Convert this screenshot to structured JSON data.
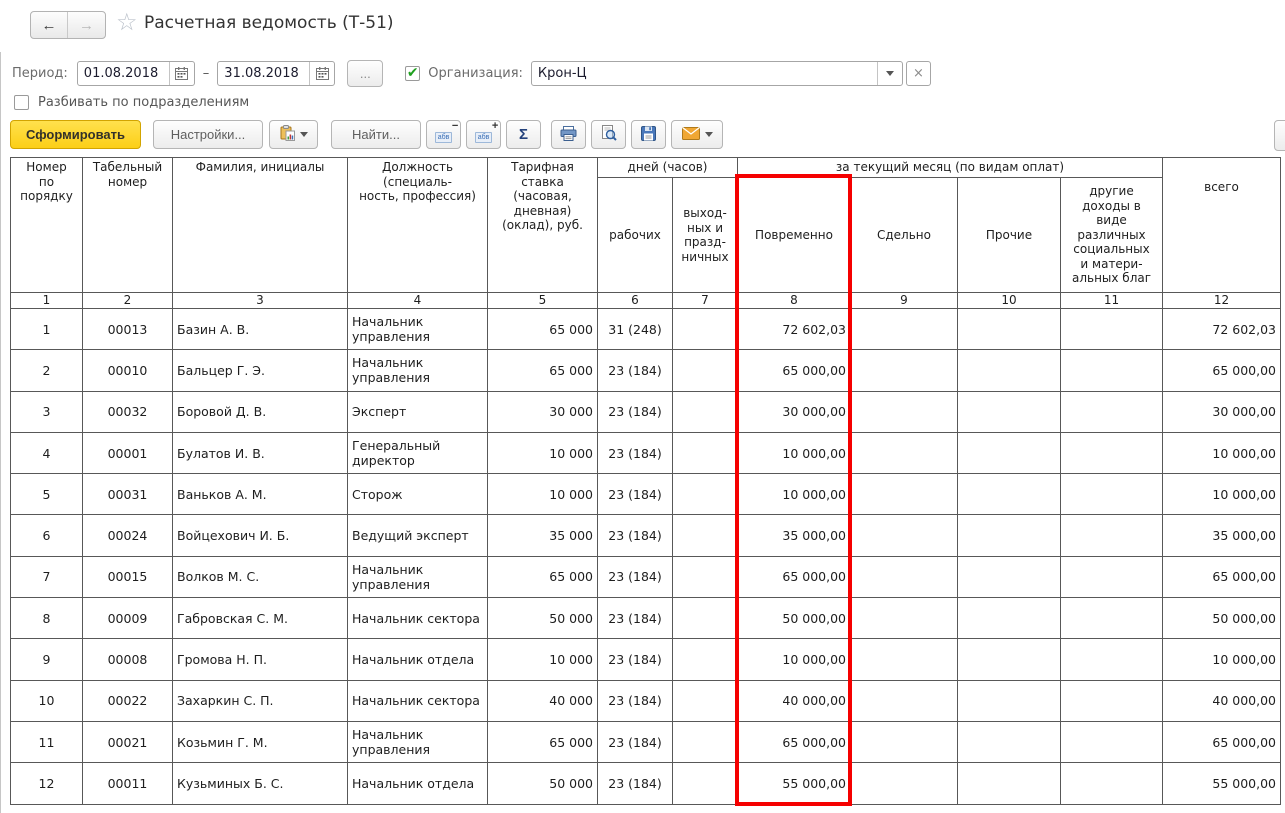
{
  "window": {
    "title": "Расчетная ведомость (Т-51)"
  },
  "nav": {
    "back_icon": "←",
    "forward_icon": "→",
    "favorite_icon": "☆"
  },
  "filters": {
    "period_label": "Период:",
    "date_from": "01.08.2018",
    "date_to": "31.08.2018",
    "dash": "–",
    "more_button": "...",
    "org_checkbox_checked": "✔",
    "org_label": "Организация:",
    "org_value": "Крон-Ц",
    "org_clear": "×",
    "split_label": "Разбивать по подразделениям"
  },
  "toolbar": {
    "generate": "Сформировать",
    "settings": "Настройки...",
    "find": "Найти...",
    "abc_letters": "абв",
    "collapse_op": "−",
    "expand_op": "+",
    "sigma": "Σ"
  },
  "icons": {
    "calendar": "calendar-icon",
    "report_variants": "report-variants-icon",
    "printer": "printer-icon",
    "preview": "print-preview-icon",
    "save": "save-icon",
    "mail": "mail-icon"
  },
  "colors": {
    "generate_yellow": "#fccf17",
    "highlight_red": "#f50000",
    "check_green": "#1fa01f"
  },
  "table": {
    "headers": {
      "num_order": "Номер\nпо\nпорядку",
      "tab_num": "Табельный\nномер",
      "name": "Фамилия, инициалы",
      "position": "Должность\n(специаль-\nность, профессия)",
      "rate": "Тарифная\nставка\n(часовая,\nдневная)\n(оклад), руб.",
      "group_days": "дней (часов)",
      "group_month": "за текущий месяц (по видам оплат)",
      "work_days": "рабочих",
      "off_days": "выход-\nных и\nпразд-\nничных",
      "time_pay": "Повременно",
      "piece_pay": "Сдельно",
      "other_pay": "Прочие",
      "other_income": "другие\nдоходы в\nвиде\nразличных\nсоциальных\nи матери-\nальных благ",
      "total": "всего"
    },
    "col_nums": [
      "1",
      "2",
      "3",
      "4",
      "5",
      "6",
      "7",
      "8",
      "9",
      "10",
      "11",
      "12"
    ],
    "rows": [
      [
        "1",
        "00013",
        "Базин А. В.",
        "Начальник\nуправления",
        "65 000",
        "31 (248)",
        "",
        "72 602,03",
        "",
        "",
        "",
        "72 602,03"
      ],
      [
        "2",
        "00010",
        "Бальцер Г. Э.",
        "Начальник\nуправления",
        "65 000",
        "23 (184)",
        "",
        "65 000,00",
        "",
        "",
        "",
        "65 000,00"
      ],
      [
        "3",
        "00032",
        "Боровой Д. В.",
        "Эксперт",
        "30 000",
        "23 (184)",
        "",
        "30 000,00",
        "",
        "",
        "",
        "30 000,00"
      ],
      [
        "4",
        "00001",
        "Булатов И. В.",
        "Генеральный\nдиректор",
        "10 000",
        "23 (184)",
        "",
        "10 000,00",
        "",
        "",
        "",
        "10 000,00"
      ],
      [
        "5",
        "00031",
        "Ваньков А. М.",
        "Сторож",
        "10 000",
        "23 (184)",
        "",
        "10 000,00",
        "",
        "",
        "",
        "10 000,00"
      ],
      [
        "6",
        "00024",
        "Войцехович И. Б.",
        "Ведущий эксперт",
        "35 000",
        "23 (184)",
        "",
        "35 000,00",
        "",
        "",
        "",
        "35 000,00"
      ],
      [
        "7",
        "00015",
        "Волков М. С.",
        "Начальник\nуправления",
        "65 000",
        "23 (184)",
        "",
        "65 000,00",
        "",
        "",
        "",
        "65 000,00"
      ],
      [
        "8",
        "00009",
        "Габровская С. М.",
        "Начальник сектора",
        "50 000",
        "23 (184)",
        "",
        "50 000,00",
        "",
        "",
        "",
        "50 000,00"
      ],
      [
        "9",
        "00008",
        "Громова Н. П.",
        "Начальник отдела",
        "10 000",
        "23 (184)",
        "",
        "10 000,00",
        "",
        "",
        "",
        "10 000,00"
      ],
      [
        "10",
        "00022",
        "Захаркин С. П.",
        "Начальник сектора",
        "40 000",
        "23 (184)",
        "",
        "40 000,00",
        "",
        "",
        "",
        "40 000,00"
      ],
      [
        "11",
        "00021",
        "Козьмин Г. М.",
        "Начальник\nуправления",
        "65 000",
        "23 (184)",
        "",
        "65 000,00",
        "",
        "",
        "",
        "65 000,00"
      ],
      [
        "12",
        "00011",
        "Кузьминых Б. С.",
        "Начальник отдела",
        "50 000",
        "23 (184)",
        "",
        "55 000,00",
        "",
        "",
        "",
        "55 000,00"
      ]
    ]
  }
}
